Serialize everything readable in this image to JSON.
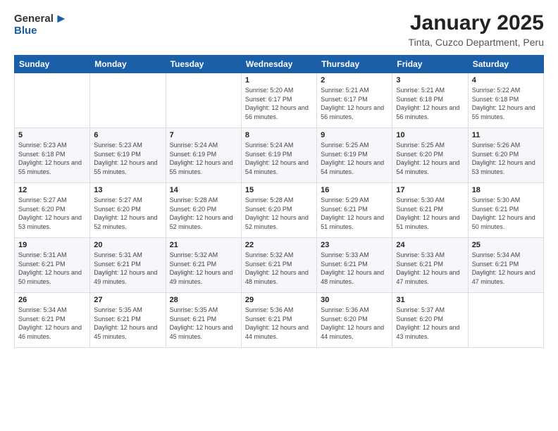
{
  "logo": {
    "general": "General",
    "blue": "Blue"
  },
  "title": "January 2025",
  "subtitle": "Tinta, Cuzco Department, Peru",
  "headers": [
    "Sunday",
    "Monday",
    "Tuesday",
    "Wednesday",
    "Thursday",
    "Friday",
    "Saturday"
  ],
  "weeks": [
    [
      {
        "day": "",
        "sunrise": "",
        "sunset": "",
        "daylight": ""
      },
      {
        "day": "",
        "sunrise": "",
        "sunset": "",
        "daylight": ""
      },
      {
        "day": "",
        "sunrise": "",
        "sunset": "",
        "daylight": ""
      },
      {
        "day": "1",
        "sunrise": "Sunrise: 5:20 AM",
        "sunset": "Sunset: 6:17 PM",
        "daylight": "Daylight: 12 hours and 56 minutes."
      },
      {
        "day": "2",
        "sunrise": "Sunrise: 5:21 AM",
        "sunset": "Sunset: 6:17 PM",
        "daylight": "Daylight: 12 hours and 56 minutes."
      },
      {
        "day": "3",
        "sunrise": "Sunrise: 5:21 AM",
        "sunset": "Sunset: 6:18 PM",
        "daylight": "Daylight: 12 hours and 56 minutes."
      },
      {
        "day": "4",
        "sunrise": "Sunrise: 5:22 AM",
        "sunset": "Sunset: 6:18 PM",
        "daylight": "Daylight: 12 hours and 55 minutes."
      }
    ],
    [
      {
        "day": "5",
        "sunrise": "Sunrise: 5:23 AM",
        "sunset": "Sunset: 6:18 PM",
        "daylight": "Daylight: 12 hours and 55 minutes."
      },
      {
        "day": "6",
        "sunrise": "Sunrise: 5:23 AM",
        "sunset": "Sunset: 6:19 PM",
        "daylight": "Daylight: 12 hours and 55 minutes."
      },
      {
        "day": "7",
        "sunrise": "Sunrise: 5:24 AM",
        "sunset": "Sunset: 6:19 PM",
        "daylight": "Daylight: 12 hours and 55 minutes."
      },
      {
        "day": "8",
        "sunrise": "Sunrise: 5:24 AM",
        "sunset": "Sunset: 6:19 PM",
        "daylight": "Daylight: 12 hours and 54 minutes."
      },
      {
        "day": "9",
        "sunrise": "Sunrise: 5:25 AM",
        "sunset": "Sunset: 6:19 PM",
        "daylight": "Daylight: 12 hours and 54 minutes."
      },
      {
        "day": "10",
        "sunrise": "Sunrise: 5:25 AM",
        "sunset": "Sunset: 6:20 PM",
        "daylight": "Daylight: 12 hours and 54 minutes."
      },
      {
        "day": "11",
        "sunrise": "Sunrise: 5:26 AM",
        "sunset": "Sunset: 6:20 PM",
        "daylight": "Daylight: 12 hours and 53 minutes."
      }
    ],
    [
      {
        "day": "12",
        "sunrise": "Sunrise: 5:27 AM",
        "sunset": "Sunset: 6:20 PM",
        "daylight": "Daylight: 12 hours and 53 minutes."
      },
      {
        "day": "13",
        "sunrise": "Sunrise: 5:27 AM",
        "sunset": "Sunset: 6:20 PM",
        "daylight": "Daylight: 12 hours and 52 minutes."
      },
      {
        "day": "14",
        "sunrise": "Sunrise: 5:28 AM",
        "sunset": "Sunset: 6:20 PM",
        "daylight": "Daylight: 12 hours and 52 minutes."
      },
      {
        "day": "15",
        "sunrise": "Sunrise: 5:28 AM",
        "sunset": "Sunset: 6:20 PM",
        "daylight": "Daylight: 12 hours and 52 minutes."
      },
      {
        "day": "16",
        "sunrise": "Sunrise: 5:29 AM",
        "sunset": "Sunset: 6:21 PM",
        "daylight": "Daylight: 12 hours and 51 minutes."
      },
      {
        "day": "17",
        "sunrise": "Sunrise: 5:30 AM",
        "sunset": "Sunset: 6:21 PM",
        "daylight": "Daylight: 12 hours and 51 minutes."
      },
      {
        "day": "18",
        "sunrise": "Sunrise: 5:30 AM",
        "sunset": "Sunset: 6:21 PM",
        "daylight": "Daylight: 12 hours and 50 minutes."
      }
    ],
    [
      {
        "day": "19",
        "sunrise": "Sunrise: 5:31 AM",
        "sunset": "Sunset: 6:21 PM",
        "daylight": "Daylight: 12 hours and 50 minutes."
      },
      {
        "day": "20",
        "sunrise": "Sunrise: 5:31 AM",
        "sunset": "Sunset: 6:21 PM",
        "daylight": "Daylight: 12 hours and 49 minutes."
      },
      {
        "day": "21",
        "sunrise": "Sunrise: 5:32 AM",
        "sunset": "Sunset: 6:21 PM",
        "daylight": "Daylight: 12 hours and 49 minutes."
      },
      {
        "day": "22",
        "sunrise": "Sunrise: 5:32 AM",
        "sunset": "Sunset: 6:21 PM",
        "daylight": "Daylight: 12 hours and 48 minutes."
      },
      {
        "day": "23",
        "sunrise": "Sunrise: 5:33 AM",
        "sunset": "Sunset: 6:21 PM",
        "daylight": "Daylight: 12 hours and 48 minutes."
      },
      {
        "day": "24",
        "sunrise": "Sunrise: 5:33 AM",
        "sunset": "Sunset: 6:21 PM",
        "daylight": "Daylight: 12 hours and 47 minutes."
      },
      {
        "day": "25",
        "sunrise": "Sunrise: 5:34 AM",
        "sunset": "Sunset: 6:21 PM",
        "daylight": "Daylight: 12 hours and 47 minutes."
      }
    ],
    [
      {
        "day": "26",
        "sunrise": "Sunrise: 5:34 AM",
        "sunset": "Sunset: 6:21 PM",
        "daylight": "Daylight: 12 hours and 46 minutes."
      },
      {
        "day": "27",
        "sunrise": "Sunrise: 5:35 AM",
        "sunset": "Sunset: 6:21 PM",
        "daylight": "Daylight: 12 hours and 45 minutes."
      },
      {
        "day": "28",
        "sunrise": "Sunrise: 5:35 AM",
        "sunset": "Sunset: 6:21 PM",
        "daylight": "Daylight: 12 hours and 45 minutes."
      },
      {
        "day": "29",
        "sunrise": "Sunrise: 5:36 AM",
        "sunset": "Sunset: 6:21 PM",
        "daylight": "Daylight: 12 hours and 44 minutes."
      },
      {
        "day": "30",
        "sunrise": "Sunrise: 5:36 AM",
        "sunset": "Sunset: 6:20 PM",
        "daylight": "Daylight: 12 hours and 44 minutes."
      },
      {
        "day": "31",
        "sunrise": "Sunrise: 5:37 AM",
        "sunset": "Sunset: 6:20 PM",
        "daylight": "Daylight: 12 hours and 43 minutes."
      },
      {
        "day": "",
        "sunrise": "",
        "sunset": "",
        "daylight": ""
      }
    ]
  ]
}
